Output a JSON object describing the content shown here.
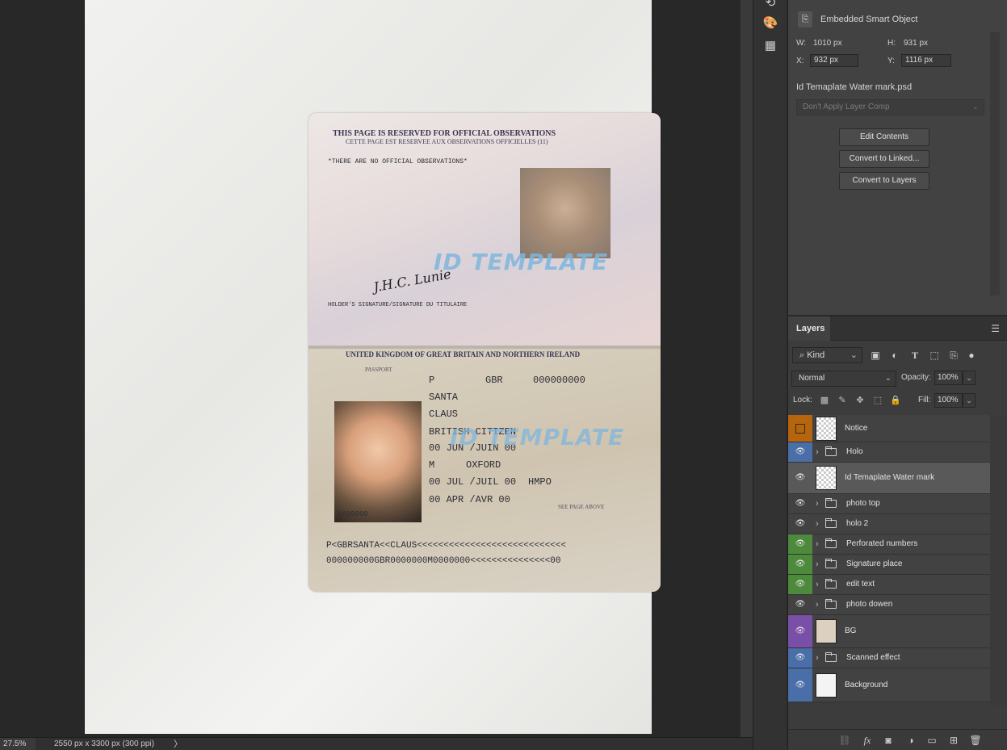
{
  "status_bar": {
    "zoom": "27.5%",
    "doc_info": "2550 px x 3300 px (300 ppi)",
    "arrow": "〉"
  },
  "passport": {
    "title_line1": "THIS PAGE IS RESERVED FOR OFFICIAL OBSERVATIONS",
    "title_line2": "CETTE PAGE EST RESERVEE AUX OBSERVATIONS OFFICIELLES (11)",
    "note": "*THERE ARE NO OFFICIAL OBSERVATIONS*",
    "signature": "J.H.C. Lunie",
    "signature_label": "HOLDER'S SIGNATURE/SIGNATURE DU TITULAIRE",
    "watermark_top": "ID TEMPLATE",
    "watermark_bottom": "ID TEMPLATE",
    "country": "UNITED KINGDOM OF GREAT BRITAIN AND NORTHERN IRELAND",
    "type_label": "PASSPORT",
    "type": "P",
    "code": "GBR",
    "number": "000000000",
    "surname": "SANTA",
    "given_names": "CLAUS",
    "nationality": "BRITISH CITIZEN",
    "dob": "00 JUN /JUIN 00",
    "sex": "M",
    "place_of_birth": "OXFORD",
    "issue_date": "00 JUL /JUIL 00",
    "authority": "HMPO",
    "expiry_date": "00 APR /AVR 00",
    "see_page": "SEE PAGE ABOVE",
    "small_number": "NA00000",
    "mrz_line1": "P<GBRSANTA<<CLAUS<<<<<<<<<<<<<<<<<<<<<<<<<<<<",
    "mrz_line2": "000000000GBR0000000M0000000<<<<<<<<<<<<<<<00"
  },
  "properties": {
    "object_type": "Embedded Smart Object",
    "w_label": "W:",
    "w_value": "1010 px",
    "h_label": "H:",
    "h_value": "931 px",
    "x_label": "X:",
    "x_value": "932 px",
    "y_label": "Y:",
    "y_value": "1116 px",
    "filename": "Id Temaplate Water mark.psd",
    "layer_comp": "Don't Apply Layer Comp",
    "buttons": {
      "edit": "Edit Contents",
      "convert_linked": "Convert to Linked...",
      "convert_layers": "Convert to Layers"
    }
  },
  "layers_panel": {
    "tab": "Layers",
    "kind": "Kind",
    "blend_mode": "Normal",
    "opacity_label": "Opacity:",
    "opacity": "100%",
    "lock_label": "Lock:",
    "fill_label": "Fill:",
    "fill": "100%",
    "layers": [
      {
        "name": "Notice",
        "color": "#b5650d",
        "kind": "smart",
        "visible": false
      },
      {
        "name": "Holo",
        "color": "#4a6ea8",
        "kind": "group",
        "visible": true
      },
      {
        "name": "Id Temaplate Water mark",
        "color": "",
        "kind": "smart",
        "visible": true,
        "selected": true
      },
      {
        "name": "photo top",
        "color": "",
        "kind": "group",
        "visible": true
      },
      {
        "name": "holo 2",
        "color": "",
        "kind": "group",
        "visible": true
      },
      {
        "name": "Perforated numbers",
        "color": "#4e8a3c",
        "kind": "group",
        "visible": true
      },
      {
        "name": "Signature place",
        "color": "#4e8a3c",
        "kind": "group",
        "visible": true
      },
      {
        "name": "edit text",
        "color": "#4e8a3c",
        "kind": "group",
        "visible": true
      },
      {
        "name": "photo dowen",
        "color": "",
        "kind": "group",
        "visible": true
      },
      {
        "name": "BG",
        "color": "#7a4fa8",
        "kind": "image",
        "visible": true
      },
      {
        "name": "Scanned effect",
        "color": "#4a6ea8",
        "kind": "group",
        "visible": true
      },
      {
        "name": "Background",
        "color": "#4a6ea8",
        "kind": "background",
        "visible": true
      }
    ]
  },
  "icons": {
    "eye": "eye-icon",
    "folder": "folder-icon",
    "link": "link-icon",
    "fx": "fx-icon",
    "mask": "mask-icon",
    "adjustment": "adjustment-icon",
    "new_group": "new-group-icon",
    "new_layer": "new-layer-icon",
    "trash": "trash-icon"
  }
}
